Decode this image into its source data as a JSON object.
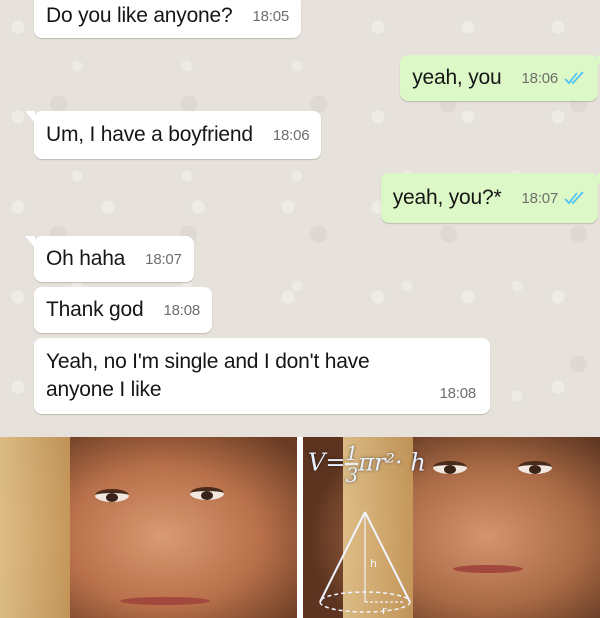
{
  "messages": [
    {
      "text": "Do you like anyone?",
      "time": "18:05",
      "direction": "incoming"
    },
    {
      "text": "yeah, you",
      "time": "18:06",
      "direction": "outgoing",
      "status": "read"
    },
    {
      "text": "Um, I have a boyfriend",
      "time": "18:06",
      "direction": "incoming"
    },
    {
      "text": "yeah, you?*",
      "time": "18:07",
      "direction": "outgoing",
      "status": "read"
    },
    {
      "text": "Oh haha",
      "time": "18:07",
      "direction": "incoming"
    },
    {
      "text": "Thank god",
      "time": "18:08",
      "direction": "incoming"
    },
    {
      "text": "Yeah, no I'm single and I don't have anyone I like",
      "time": "18:08",
      "direction": "incoming"
    }
  ],
  "colors": {
    "chat_background": "#e6e1da",
    "incoming_bubble": "#ffffff",
    "outgoing_bubble": "#dcf8c6",
    "read_ticks": "#4fc3f7"
  },
  "icons": {
    "read_receipt": "double-check-icon"
  },
  "meme": {
    "description_icon": "math-lady-meme",
    "formula_v": "V",
    "formula_eq": "=",
    "formula_num": "1",
    "formula_den": "3",
    "formula_rest": "πr²· h",
    "cone_label_h": "h",
    "cone_label_r": "r"
  }
}
